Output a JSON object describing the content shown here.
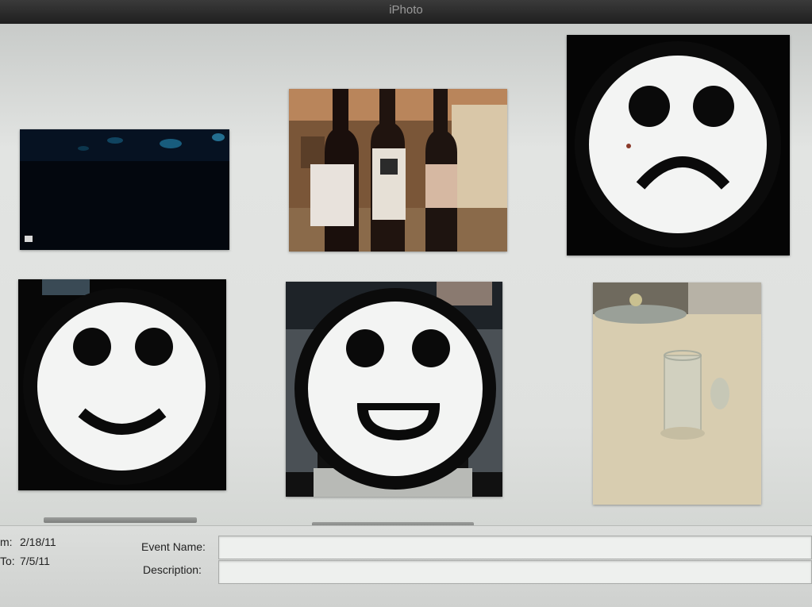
{
  "window": {
    "title": "iPhoto"
  },
  "thumbnails": [
    {
      "name": "dark-underwater-photo"
    },
    {
      "name": "wine-bottles-photo"
    },
    {
      "name": "sad-face-icon"
    },
    {
      "name": "smiley-face-icon"
    },
    {
      "name": "grinning-face-icon"
    },
    {
      "name": "glass-on-table-photo"
    }
  ],
  "event_info": {
    "from_label": "m:",
    "from_date": "2/18/11",
    "to_label": "To:",
    "to_date": "7/5/11",
    "event_name_label": "Event Name:",
    "event_name_value": "",
    "description_label": "Description:",
    "description_value": ""
  }
}
